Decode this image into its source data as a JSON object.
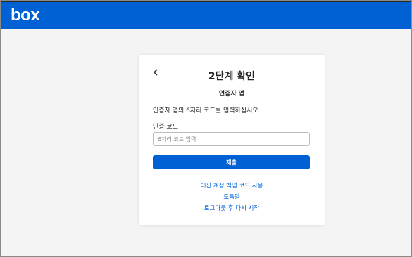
{
  "header": {
    "logo_text": "box",
    "bar_color": "#0061d5"
  },
  "card": {
    "back_icon": "chevron-left-icon",
    "title": "2단계 확인",
    "subtitle": "인증자 앱",
    "instruction": "인증자 앱의 6자리 코드를 입력하십시오.",
    "code_label": "인증 코드",
    "code_input": {
      "value": "",
      "placeholder": "6자리 코드 입력"
    },
    "submit_label": "제출",
    "links": [
      "대신 계정 백업 코드 사용",
      "도움말",
      "로그아웃 후 다시 시작"
    ]
  }
}
